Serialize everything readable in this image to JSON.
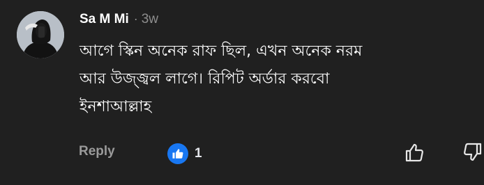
{
  "comment": {
    "author": "Sa M Mi",
    "separator": "·",
    "time_ago": "3w",
    "text": "আগে স্কিন অনেক রাফ ছিল, এখন অনেক নরম\nআর উজ্জ্বল লাগে। রিপিট অর্ডার করবো\nইনশাআল্লাহ",
    "actions": {
      "reply_label": "Reply",
      "like_count": "1"
    }
  },
  "colors": {
    "background": "#202020",
    "like_badge": "#1877f2",
    "muted_text": "#8e8e8e"
  },
  "icons": {
    "like_badge": "thumbs-up-icon",
    "like_button": "thumbs-up-outline-icon",
    "dislike_button": "thumbs-down-outline-icon"
  }
}
